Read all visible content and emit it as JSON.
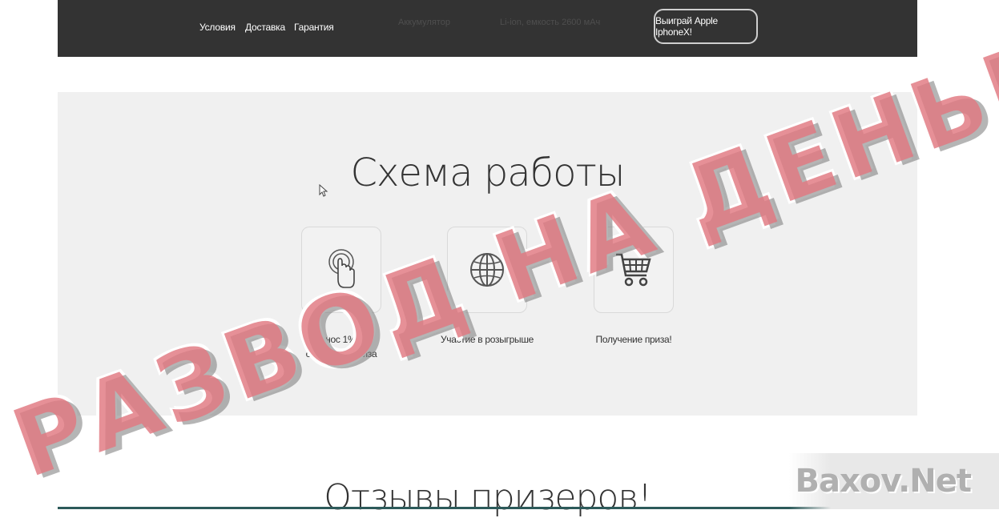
{
  "nav": {
    "links": [
      "Условия",
      "Доставка",
      "Гарантия"
    ],
    "faint_left": "Аккумулятор",
    "faint_right": "Li-ion, емкость 2600 мАч",
    "cta_label": "Выиграй Apple IphoneX!"
  },
  "scheme": {
    "title": "Схема работы",
    "steps": [
      {
        "icon": "tap-hand-icon",
        "label_line1": "Взнос 1% от",
        "label_line2": "стоимости приза"
      },
      {
        "icon": "globe-icon",
        "label_line1": "Участие в розыгрыше",
        "label_line2": ""
      },
      {
        "icon": "shopping-cart-icon",
        "label_line1": "Получение приза!",
        "label_line2": ""
      }
    ]
  },
  "stamp_text": "РАЗВОД НА ДЕНЬГИ",
  "reviews": {
    "title": "Отзывы призеров!"
  },
  "watermark": "Baxov.Net",
  "colors": {
    "nav_bg": "#333333",
    "section_bg": "#f0f0f0",
    "stamp": "#e07880"
  }
}
